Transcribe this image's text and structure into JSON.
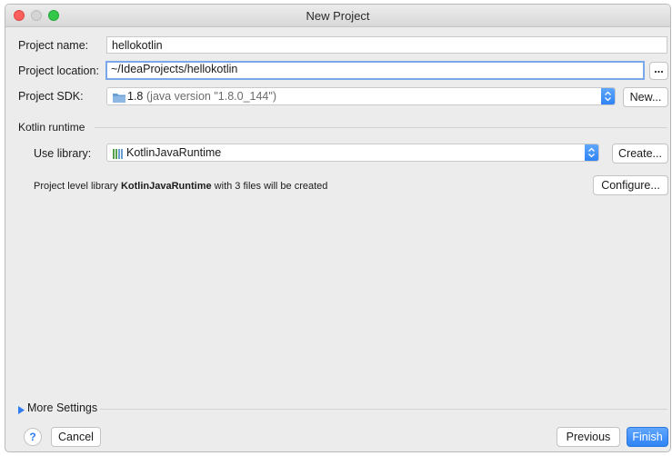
{
  "window": {
    "title": "New Project"
  },
  "project_name": {
    "label": "Project name:",
    "value": "hellokotlin"
  },
  "project_location": {
    "label": "Project location:",
    "value": "~/IdeaProjects/hellokotlin",
    "browse_label": "..."
  },
  "project_sdk": {
    "label": "Project SDK:",
    "version": "1.8",
    "detail": "(java version \"1.8.0_144\")",
    "new_label": "New..."
  },
  "kotlin_runtime": {
    "section_title": "Kotlin runtime",
    "use_library_label": "Use library:",
    "library_value": "KotlinJavaRuntime",
    "create_label": "Create...",
    "info_prefix": "Project level library ",
    "info_library": "KotlinJavaRuntime",
    "info_suffix": " with 3 files will be created",
    "configure_label": "Configure..."
  },
  "more_settings": {
    "label": "More Settings"
  },
  "footer": {
    "help_label": "?",
    "cancel_label": "Cancel",
    "previous_label": "Previous",
    "finish_label": "Finish"
  },
  "colors": {
    "accent": "#2f83f5",
    "focus_ring": "#7aa7ea",
    "folder_icon": "#6b9fd3",
    "library_icon": "#52a04a"
  },
  "icons": {
    "sdk": "folder-icon",
    "library": "library-icon",
    "combo_arrow": "up-down-arrow-icon",
    "disclosure": "triangle-right-icon"
  }
}
